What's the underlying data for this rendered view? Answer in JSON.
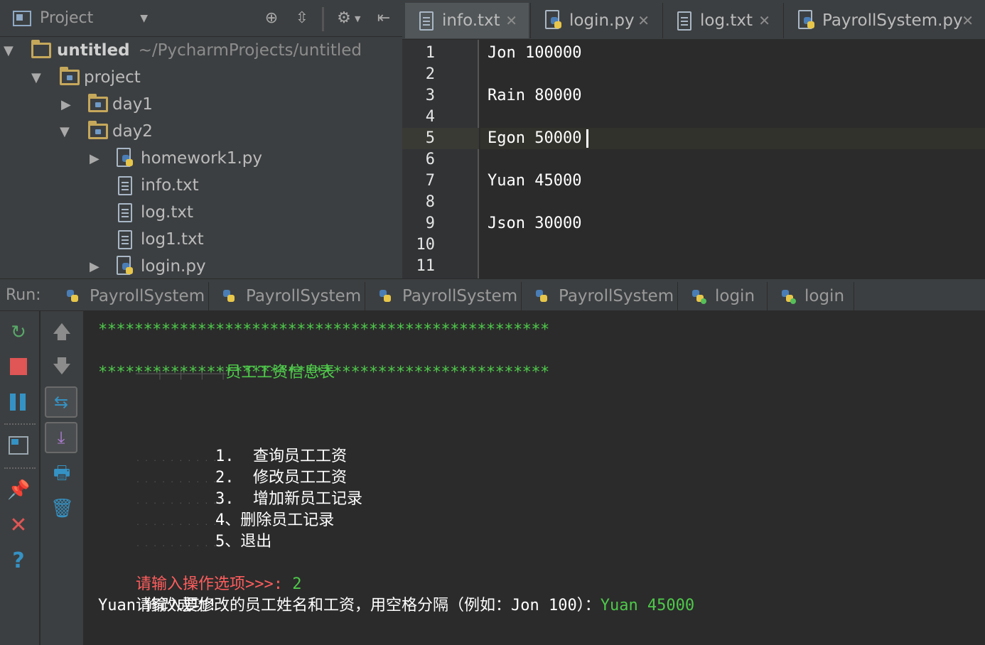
{
  "project_panel": {
    "title": "Project",
    "tree": [
      {
        "label": "untitled",
        "path": "~/PycharmProjects/untitled"
      },
      {
        "label": "project"
      },
      {
        "label": "day1"
      },
      {
        "label": "day2"
      },
      {
        "label": "homework1.py"
      },
      {
        "label": "info.txt"
      },
      {
        "label": "log.txt"
      },
      {
        "label": "log1.txt"
      },
      {
        "label": "login.py"
      }
    ]
  },
  "editor": {
    "tabs": [
      {
        "label": "info.txt"
      },
      {
        "label": "login.py"
      },
      {
        "label": "log.txt"
      },
      {
        "label": "PayrollSystem.py"
      }
    ],
    "line_numbers": [
      "1",
      "2",
      "3",
      "4",
      "5",
      "6",
      "7",
      "8",
      "9",
      "10",
      "11"
    ],
    "lines": [
      "Jon 100000",
      "",
      "Rain 80000",
      "",
      "Egon 50000",
      "",
      "Yuan 45000",
      "",
      "Json 30000",
      "",
      ""
    ]
  },
  "run": {
    "label": "Run:",
    "tabs": [
      "PayrollSystem",
      "PayrollSystem",
      "PayrollSystem",
      "PayrollSystem",
      "login",
      "login"
    ]
  },
  "console": {
    "stars": "**************************************************",
    "header_prefix": "────┼───┼───┼───┼",
    "header_title": "员工工资信息表",
    "menu": [
      "1.  查询员工工资",
      "2.  修改员工工资",
      "3.  增加新员工记录",
      "4、删除员工记录",
      "5、退出"
    ],
    "menu_indent": ". . . . . . . . . .",
    "prompt": "请输入操作选项>>>:",
    "prompt_answer": " 2",
    "input_prompt": "请输入要修改的员工姓名和工资，用空格分隔（例如：Jon 100）：",
    "input_answer": "Yuan 45000",
    "result": "Yuan 修改成功!"
  },
  "colors": {
    "console_green": "#4ec94a",
    "console_red": "#ff5d5d",
    "panel_bg": "#3c3f41",
    "editor_bg": "#2b2b2b"
  }
}
